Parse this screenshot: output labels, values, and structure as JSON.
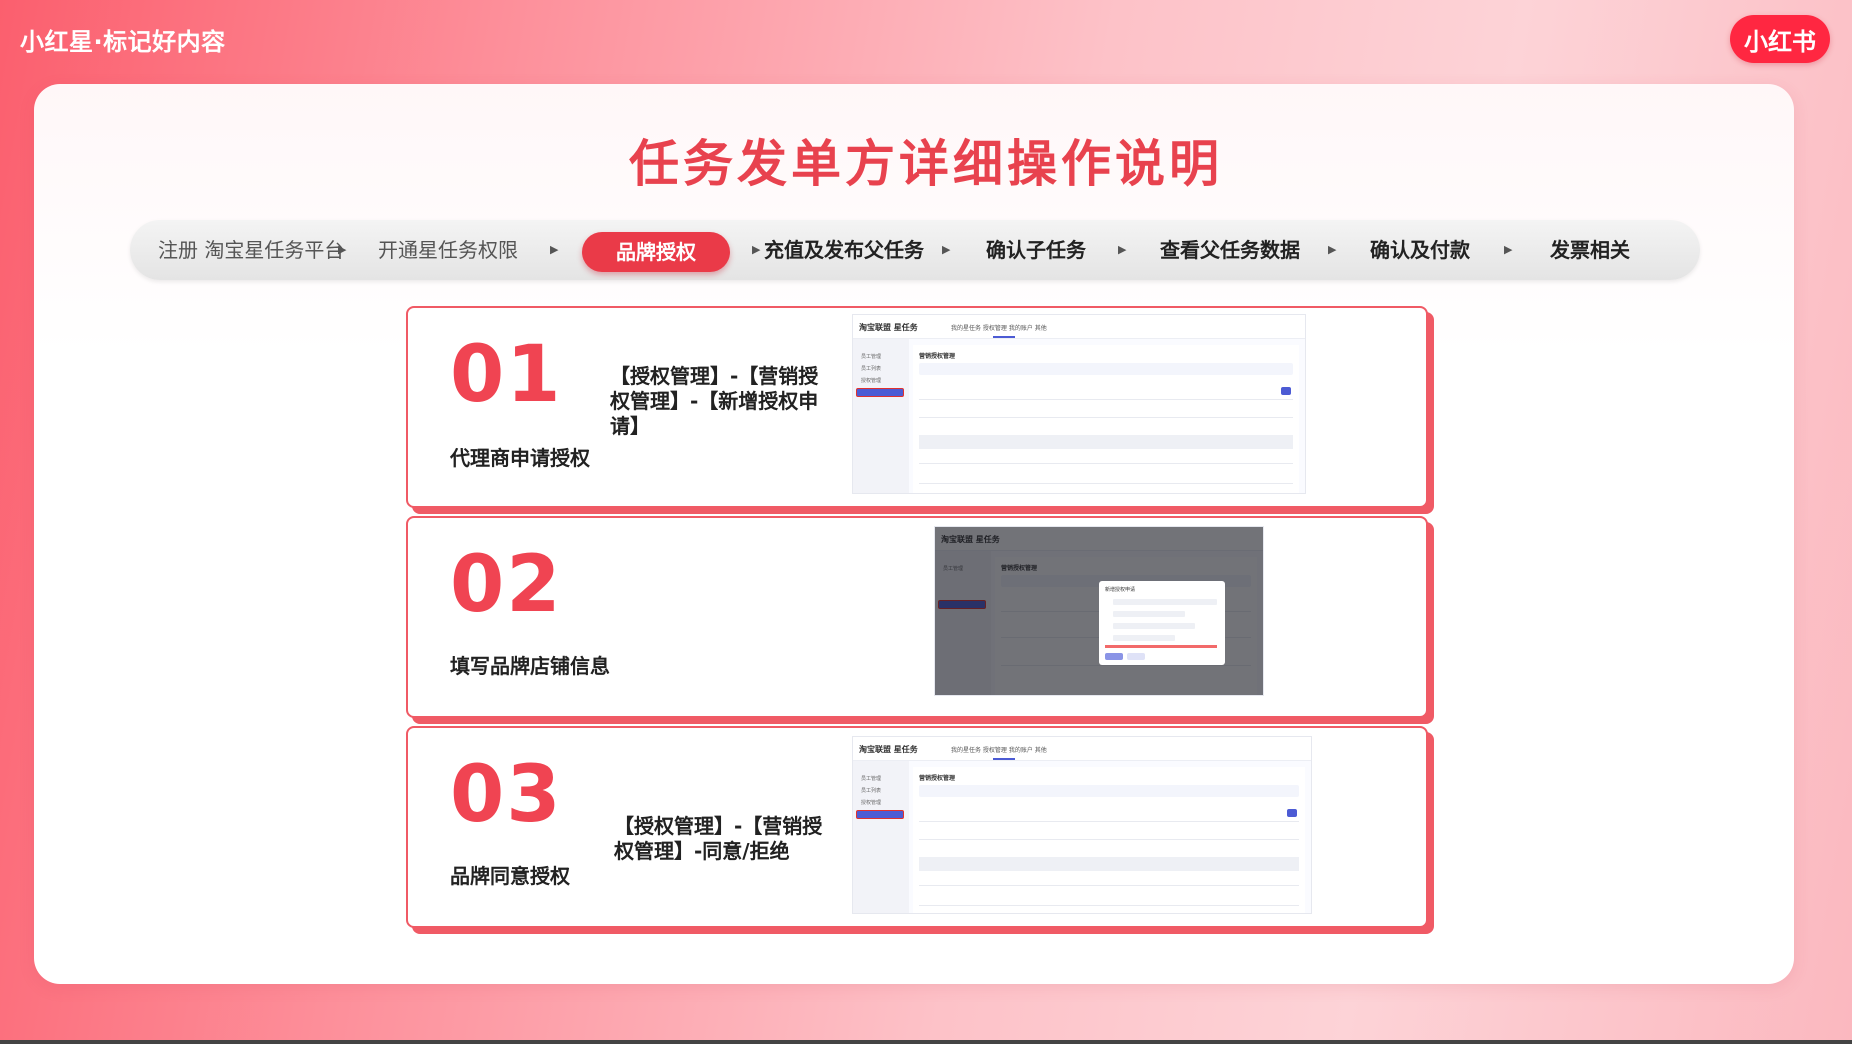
{
  "header": {
    "brand_title": "小红星·标记好内容",
    "logo_text": "小红书"
  },
  "page_title": "任务发单方详细操作说明",
  "steps": [
    {
      "label": "注册 淘宝星任务平台"
    },
    {
      "label": "开通星任务权限"
    },
    {
      "label": "品牌授权",
      "active": true
    },
    {
      "label": "充值及发布父任务"
    },
    {
      "label": "确认子任务"
    },
    {
      "label": "查看父任务数据"
    },
    {
      "label": "确认及付款"
    },
    {
      "label": "发票相关"
    }
  ],
  "cards": [
    {
      "number": "01",
      "label": "代理商申请授权",
      "desc": "【授权管理】-【营销授权管理】-【新增授权申请】"
    },
    {
      "number": "02",
      "label": "填写品牌店铺信息",
      "desc": ""
    },
    {
      "number": "03",
      "label": "品牌同意授权",
      "desc": "【授权管理】-【营销授权管理】-同意/拒绝"
    }
  ],
  "screenshot_mock": {
    "logo": "淘宝联盟 星任务",
    "nav": "我的星任务    授权管理    我的账户    其他",
    "page_heading": "营销授权管理",
    "sidebar_items": [
      "员工管理",
      "员工列表",
      "授权管理",
      "营销授权管理"
    ],
    "dialog_title": "新增授权申请"
  },
  "colors": {
    "accent": "#e8424e",
    "active_step": "#ea3a48",
    "logo_red": "#ff2741",
    "card_border": "#f05a65"
  }
}
